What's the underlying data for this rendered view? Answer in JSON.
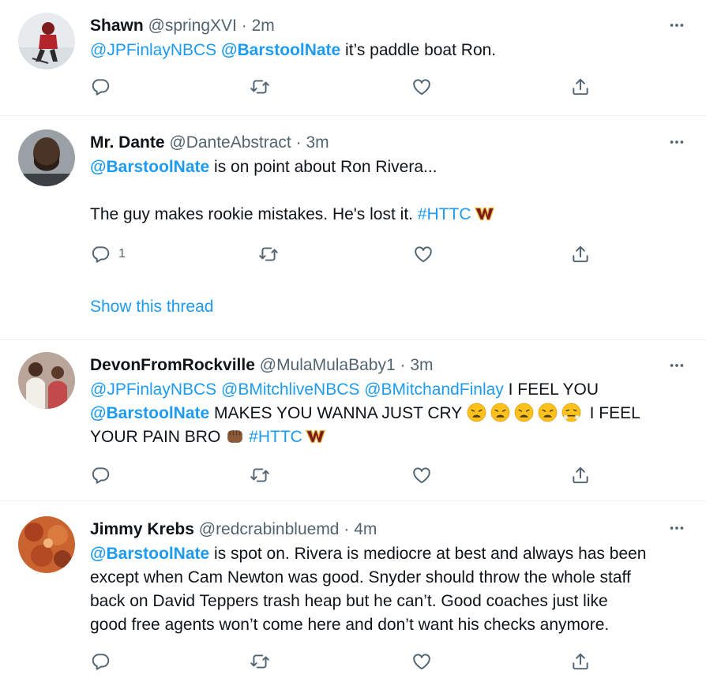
{
  "icons": {
    "more": "more-dots-icon",
    "reply": "reply-icon",
    "retweet": "retweet-icon",
    "like": "like-icon",
    "share": "share-icon"
  },
  "colors": {
    "link": "#1d9bf0",
    "secondary": "#536471",
    "divider": "#eff3f4"
  },
  "tweets": [
    {
      "name": "Shawn",
      "handle": "@springXVI",
      "sep": "·",
      "time": "2m",
      "body": {
        "m1": "@JPFinlayNBCS",
        "m2": "@BarstoolNate",
        "t1": " it’s paddle boat Ron."
      },
      "reply_count": ""
    },
    {
      "name": "Mr. Dante",
      "handle": "@DanteAbstract",
      "sep": "·",
      "time": "3m",
      "body": {
        "m1": "@BarstoolNate",
        "t1": " is on point about Ron Rivera...",
        "t2": "The guy makes rookie mistakes. He's lost it. ",
        "h1": "#HTTC"
      },
      "reply_count": "1",
      "show_thread": "Show this thread"
    },
    {
      "name": "DevonFromRockville",
      "handle": "@MulaMulaBaby1",
      "sep": "·",
      "time": "3m",
      "body": {
        "m1": "@JPFinlayNBCS",
        "m2": "@BMitchliveNBCS",
        "m3": "@BMitchandFinlay",
        "t1": " I FEEL YOU",
        "m4": "@BarstoolNate",
        "t2": " MAKES YOU WANNA JUST CRY ",
        "t3": " I FEEL",
        "t4": "YOUR PAIN BRO ",
        "h1": "#HTTC"
      },
      "reply_count": ""
    },
    {
      "name": "Jimmy Krebs",
      "handle": "@redcrabinbluemd",
      "sep": "·",
      "time": "4m",
      "body": {
        "m1": "@BarstoolNate",
        "l1": " is spot on. Rivera is mediocre at best and always has been",
        "l2": "except when Cam Newton was good. Snyder should throw the whole staff",
        "l3": "back on David Teppers trash heap but he can’t. Good coaches just like",
        "l4": "good free agents won’t come here and don’t want his checks anymore."
      },
      "reply_count": ""
    }
  ]
}
